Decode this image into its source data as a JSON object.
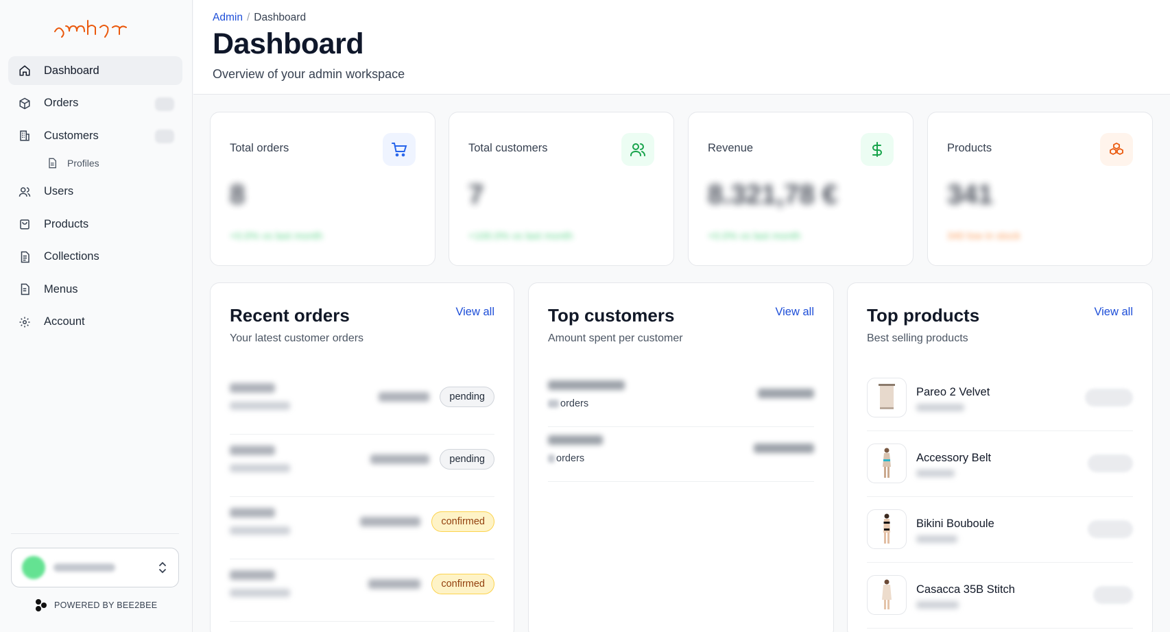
{
  "brand": {
    "logo_text": "ɣmhɣr"
  },
  "sidebar": {
    "items": [
      {
        "label": "Dashboard",
        "icon": "home-icon",
        "active": true
      },
      {
        "label": "Orders",
        "icon": "box-icon"
      },
      {
        "label": "Customers",
        "icon": "building-icon"
      },
      {
        "label": "Profiles",
        "icon": "file-icon",
        "sub": true
      },
      {
        "label": "Users",
        "icon": "users-icon"
      },
      {
        "label": "Products",
        "icon": "bag-icon"
      },
      {
        "label": "Collections",
        "icon": "document-icon"
      },
      {
        "label": "Menus",
        "icon": "list-doc-icon"
      },
      {
        "label": "Account",
        "icon": "gear-icon"
      }
    ],
    "powered_by": "POWERED BY BEE2BEE"
  },
  "header": {
    "breadcrumb_root": "Admin",
    "breadcrumb_sep": "/",
    "breadcrumb_current": "Dashboard",
    "title": "Dashboard",
    "subtitle": "Overview of your admin workspace"
  },
  "stats": [
    {
      "label": "Total orders",
      "icon": "cart-icon",
      "accent": "#2563eb",
      "bg": "#eff4ff",
      "value": "8",
      "delta": "+0.0% vs last month",
      "delta_color": "#22c55e"
    },
    {
      "label": "Total customers",
      "icon": "users-icon",
      "accent": "#16a34a",
      "bg": "#ecfdf3",
      "value": "7",
      "delta": "+100.0% vs last month",
      "delta_color": "#22c55e"
    },
    {
      "label": "Revenue",
      "icon": "dollar-icon",
      "accent": "#16a34a",
      "bg": "#ecfdf3",
      "value": "8.321,78 €",
      "delta": "+0.0% vs last month",
      "delta_color": "#22c55e"
    },
    {
      "label": "Products",
      "icon": "cubes-icon",
      "accent": "#ea580c",
      "bg": "#fff4ec",
      "value": "341",
      "delta": "340 low in stock",
      "delta_color": "#f97316"
    }
  ],
  "recent_orders": {
    "title": "Recent orders",
    "subtitle": "Your latest customer orders",
    "view_all": "View all",
    "rows": [
      {
        "status": "pending"
      },
      {
        "status": "pending"
      },
      {
        "status": "confirmed"
      },
      {
        "status": "confirmed"
      }
    ]
  },
  "top_customers": {
    "title": "Top customers",
    "subtitle": "Amount spent per customer",
    "view_all": "View all",
    "rows": [
      {
        "orders_label": "orders"
      },
      {
        "orders_label": "orders"
      }
    ]
  },
  "top_products": {
    "title": "Top products",
    "subtitle": "Best selling products",
    "view_all": "View all",
    "rows": [
      {
        "name": "Pareo 2 Velvet"
      },
      {
        "name": "Accessory Belt"
      },
      {
        "name": "Bikini Bouboule"
      },
      {
        "name": "Casacca 35B Stitch"
      }
    ]
  }
}
